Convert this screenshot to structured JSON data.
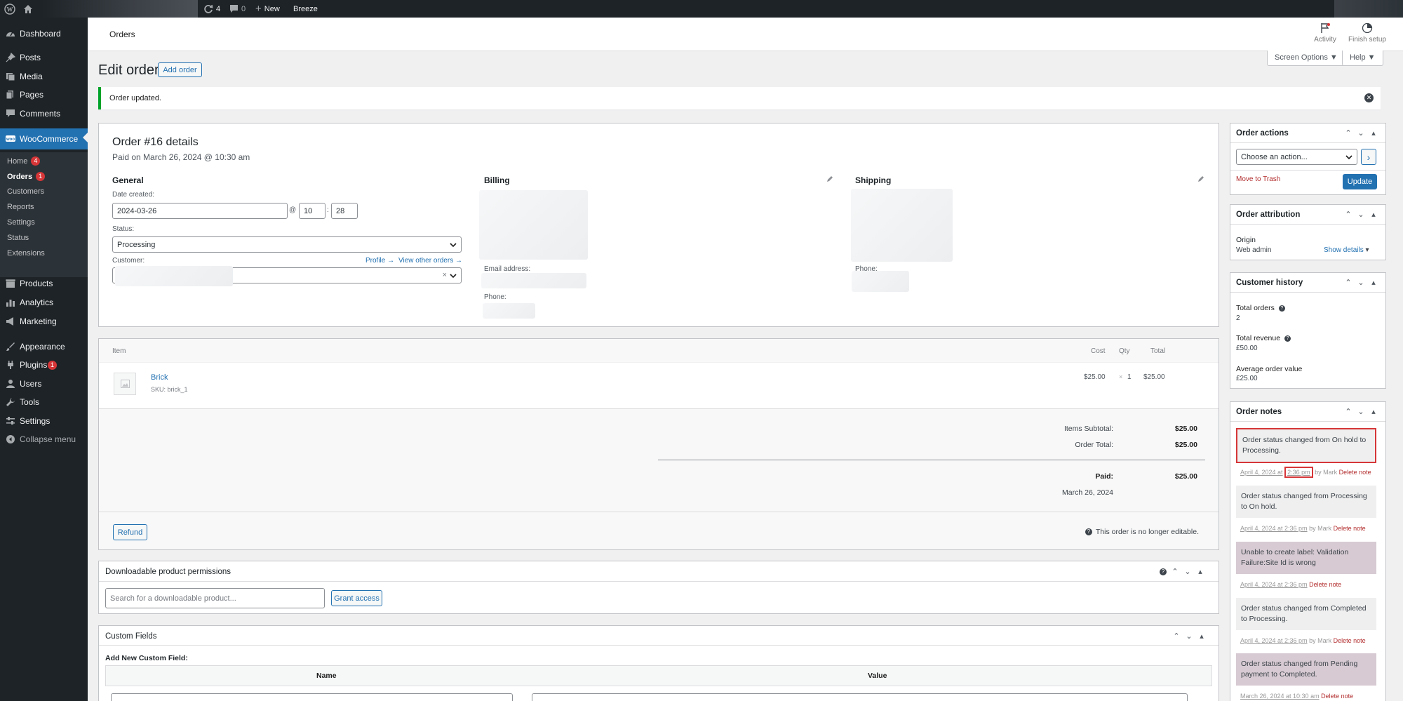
{
  "adminbar": {
    "updates": "4",
    "comments": "0",
    "new_label": "New",
    "breeze_label": "Breeze"
  },
  "sidebar": {
    "items": [
      {
        "label": "Dashboard"
      },
      {
        "label": "Posts"
      },
      {
        "label": "Media"
      },
      {
        "label": "Pages"
      },
      {
        "label": "Comments"
      },
      {
        "label": "WooCommerce"
      },
      {
        "label": "Products"
      },
      {
        "label": "Analytics"
      },
      {
        "label": "Marketing"
      },
      {
        "label": "Appearance"
      },
      {
        "label": "Plugins",
        "badge": "1"
      },
      {
        "label": "Users"
      },
      {
        "label": "Tools"
      },
      {
        "label": "Settings"
      },
      {
        "label": "Collapse menu"
      }
    ],
    "submenu": [
      {
        "label": "Home",
        "badge": "4"
      },
      {
        "label": "Orders",
        "badge": "1"
      },
      {
        "label": "Customers"
      },
      {
        "label": "Reports"
      },
      {
        "label": "Settings"
      },
      {
        "label": "Status"
      },
      {
        "label": "Extensions"
      }
    ]
  },
  "header": {
    "title": "Orders",
    "activity": "Activity",
    "finish_setup": "Finish setup",
    "screen_options": "Screen Options ▼",
    "help": "Help ▼"
  },
  "page": {
    "title": "Edit order",
    "add_order": "Add order",
    "notice": "Order updated."
  },
  "order": {
    "heading": "Order #16 details",
    "paid_on": "Paid on March 26, 2024 @ 10:30 am",
    "general": "General",
    "date_created_label": "Date created:",
    "date": "2024-03-26",
    "at": "@",
    "hour": "10",
    "colon": ":",
    "minute": "28",
    "status_label": "Status:",
    "status": "Processing",
    "customer_label": "Customer:",
    "profile_link": "Profile →",
    "view_orders_link": "View other orders →",
    "clear_x": "×",
    "billing": "Billing",
    "email_label": "Email address:",
    "phone_label": "Phone:",
    "shipping": "Shipping",
    "shipping_phone_label": "Phone:"
  },
  "items": {
    "col_item": "Item",
    "col_cost": "Cost",
    "col_qty": "Qty",
    "col_total": "Total",
    "rows": [
      {
        "name": "Brick",
        "sku": "SKU: brick_1",
        "cost": "$25.00",
        "qty_x": "×",
        "qty": "1",
        "total": "$25.00"
      }
    ],
    "subtotal_label": "Items Subtotal:",
    "subtotal": "$25.00",
    "order_total_label": "Order Total:",
    "order_total": "$25.00",
    "paid_label": "Paid:",
    "paid": "$25.00",
    "paid_date": "March 26, 2024",
    "refund": "Refund",
    "not_editable": "This order is no longer editable."
  },
  "downloads": {
    "title": "Downloadable product permissions",
    "search_placeholder": "Search for a downloadable product...",
    "grant": "Grant access"
  },
  "custom_fields": {
    "title": "Custom Fields",
    "add_new": "Add New Custom Field:",
    "col_name": "Name",
    "col_value": "Value"
  },
  "actions": {
    "title": "Order actions",
    "select": "Choose an action...",
    "go": "›",
    "trash": "Move to Trash",
    "update": "Update"
  },
  "attribution": {
    "title": "Order attribution",
    "origin_label": "Origin",
    "origin_value": "Web admin",
    "show_details": "Show details"
  },
  "history": {
    "title": "Customer history",
    "total_orders_label": "Total orders",
    "total_orders": "2",
    "total_revenue_label": "Total revenue",
    "total_revenue": "£50.00",
    "avg_label": "Average order value",
    "avg": "£25.00"
  },
  "notes": {
    "title": "Order notes",
    "delete": "Delete note",
    "items": [
      {
        "text": "Order status changed from On hold to Processing.",
        "date": "April 4, 2024 at",
        "time": "2:36 pm",
        "by": "by Mark"
      },
      {
        "text": "Order status changed from Processing to On hold.",
        "date": "April 4, 2024 at 2:36 pm",
        "by": "by Mark"
      },
      {
        "text": "Unable to create label: Validation Failure:Site Id is wrong",
        "date": "April 4, 2024 at 2:36 pm",
        "by": ""
      },
      {
        "text": "Order status changed from Completed to Processing.",
        "date": "April 4, 2024 at 2:36 pm",
        "by": "by Mark"
      },
      {
        "text": "Order status changed from Pending payment to Completed.",
        "date": "March 26, 2024 at 10:30 am",
        "by": ""
      }
    ]
  },
  "colors": {
    "accent": "#2271b1",
    "sidebar": "#1d2327",
    "highlight": "#d63638",
    "note_system": "#d7cad2"
  }
}
